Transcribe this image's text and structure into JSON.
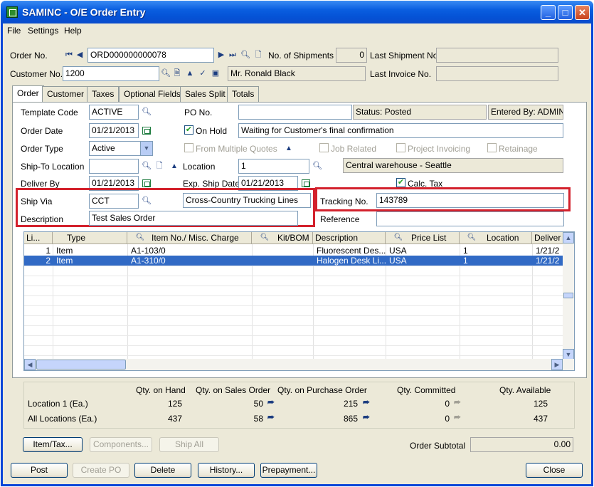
{
  "window": {
    "title": "SAMINC - O/E Order Entry"
  },
  "menu": [
    "File",
    "Settings",
    "Help"
  ],
  "header": {
    "order_no_label": "Order No.",
    "order_no": "ORD000000000078",
    "shipments_label": "No. of Shipments",
    "shipments": "0",
    "last_shipment_label": "Last Shipment No.",
    "last_shipment": "",
    "customer_no_label": "Customer No.",
    "customer_no": "1200",
    "customer_name": "Mr. Ronald Black",
    "last_invoice_label": "Last Invoice No.",
    "last_invoice": ""
  },
  "tabs": [
    "Order",
    "Customer",
    "Taxes",
    "Optional Fields",
    "Sales Split",
    "Totals"
  ],
  "order": {
    "template_code_label": "Template Code",
    "template_code": "ACTIVE",
    "po_no_label": "PO No.",
    "po_no": "",
    "status": "Status: Posted",
    "entered_by": "Entered By: ADMIN",
    "order_date_label": "Order Date",
    "order_date": "01/21/2013",
    "on_hold_label": "On Hold",
    "on_hold_reason": "Waiting for Customer's final confirmation",
    "order_type_label": "Order Type",
    "order_type": "Active",
    "from_quotes_label": "From Multiple Quotes",
    "job_related_label": "Job Related",
    "project_invoicing_label": "Project Invoicing",
    "retainage_label": "Retainage",
    "ship_to_label": "Ship-To Location",
    "ship_to": "",
    "location_label": "Location",
    "location": "1",
    "location_desc": "Central warehouse - Seattle",
    "deliver_by_label": "Deliver By",
    "deliver_by": "01/21/2013",
    "exp_ship_label": "Exp. Ship Date",
    "exp_ship": "01/21/2013",
    "calc_tax_label": "Calc. Tax",
    "ship_via_label": "Ship Via",
    "ship_via": "CCT",
    "ship_via_desc": "Cross-Country Trucking Lines",
    "tracking_label": "Tracking No.",
    "tracking": "143789",
    "description_label": "Description",
    "description": "Test Sales Order",
    "reference_label": "Reference",
    "reference": ""
  },
  "grid": {
    "headers": [
      "Li...",
      "Type",
      "Item No./ Misc. Charge",
      "Kit/BOM",
      "Description",
      "Price List",
      "Location",
      "Deliver"
    ],
    "rows": [
      [
        "1",
        "Item",
        "A1-103/0",
        "",
        "Fluorescent Des...",
        "USA",
        "1",
        "1/21/2"
      ],
      [
        "2",
        "Item",
        "A1-310/0",
        "",
        "Halogen Desk Li...",
        "USA",
        "1",
        "1/21/2"
      ]
    ]
  },
  "summary": {
    "headers": [
      "Qty. on Hand",
      "Qty. on Sales Order",
      "Qty. on Purchase Order",
      "Qty. Committed",
      "Qty. Available"
    ],
    "rows": [
      {
        "label": "Location  1 (Ea.)",
        "values": [
          "125",
          "50",
          "215",
          "0",
          "125"
        ]
      },
      {
        "label": "All Locations (Ea.)",
        "values": [
          "437",
          "58",
          "865",
          "0",
          "437"
        ]
      }
    ]
  },
  "buttons": {
    "item_tax": "Item/Tax...",
    "components": "Components...",
    "ship_all": "Ship All",
    "post": "Post",
    "create_po": "Create PO",
    "delete": "Delete",
    "history": "History...",
    "prepayment": "Prepayment...",
    "close": "Close"
  },
  "subtotal": {
    "label": "Order Subtotal",
    "value": "0.00"
  }
}
